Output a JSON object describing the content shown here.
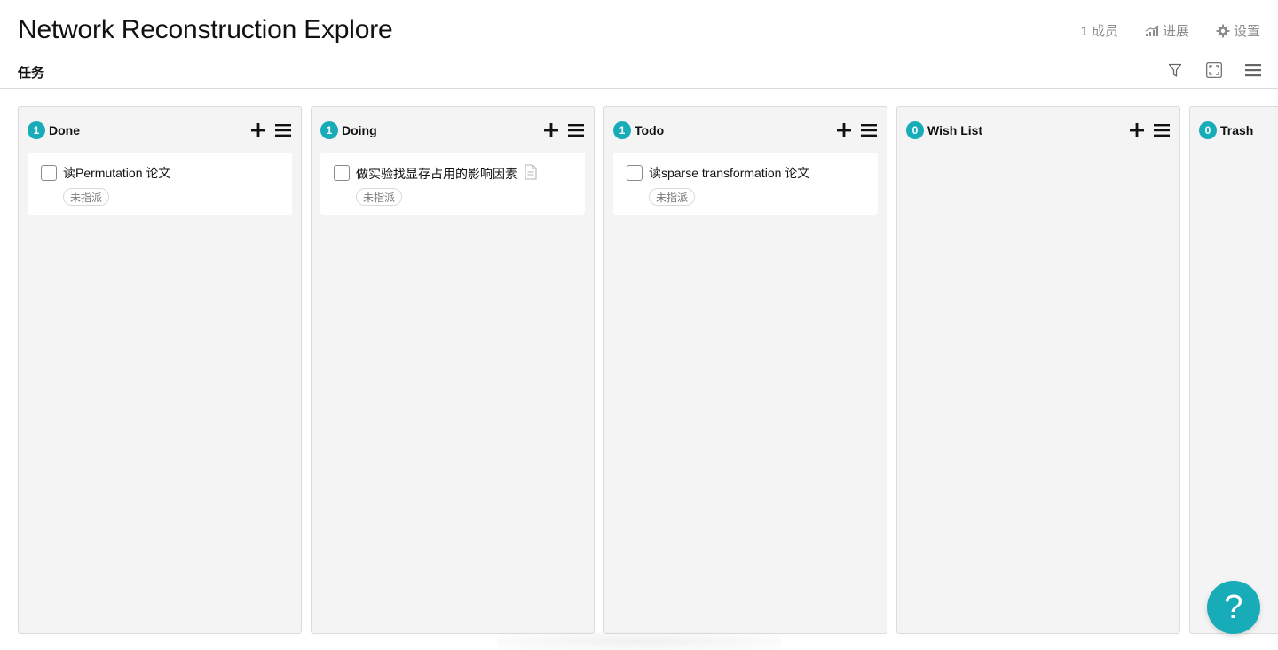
{
  "project": {
    "title": "Network Reconstruction Explore"
  },
  "section": {
    "label": "任务"
  },
  "top_actions": {
    "members": "1 成员",
    "progress": "进展",
    "settings": "设置"
  },
  "colors": {
    "accent": "#17acb8",
    "column_bg": "#f4f4f4",
    "muted": "#8c8c8c"
  },
  "icons": {
    "progress": "bar-chart-icon",
    "settings": "gear-icon",
    "filter": "filter-icon",
    "fullscreen": "fullscreen-icon",
    "menu": "hamburger-menu-icon",
    "add": "plus-icon",
    "column_menu": "list-menu-icon",
    "note": "document-icon"
  },
  "columns": [
    {
      "count": "1",
      "title": "Done",
      "cards": [
        {
          "title": "读Permutation 论文",
          "tag": "未指派",
          "has_note": false
        }
      ]
    },
    {
      "count": "1",
      "title": "Doing",
      "cards": [
        {
          "title": "做实验找显存占用的影响因素",
          "tag": "未指派",
          "has_note": true
        }
      ]
    },
    {
      "count": "1",
      "title": "Todo",
      "cards": [
        {
          "title": "读sparse transformation 论文",
          "tag": "未指派",
          "has_note": false
        }
      ]
    },
    {
      "count": "0",
      "title": "Wish List",
      "cards": []
    },
    {
      "count": "0",
      "title": "Trash",
      "cards": []
    }
  ],
  "help": {
    "label": "?"
  }
}
